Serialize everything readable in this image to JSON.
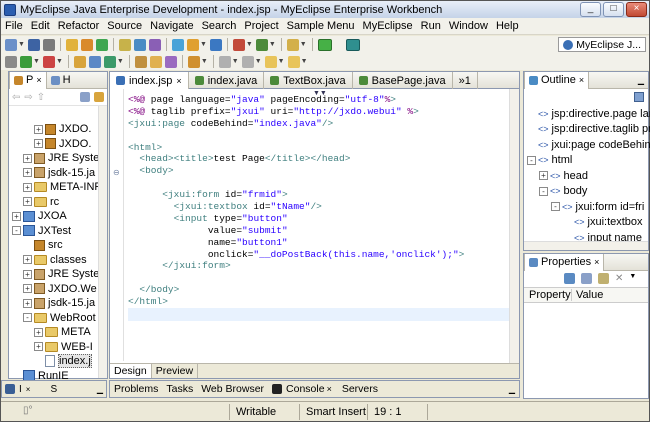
{
  "window": {
    "title": "MyEclipse Java Enterprise Development - index.jsp - MyEclipse Enterprise Workbench",
    "minimize": "_",
    "maximize": "□",
    "close": "×"
  },
  "menu": [
    "File",
    "Edit",
    "Refactor",
    "Source",
    "Navigate",
    "Search",
    "Project",
    "Sample Menu",
    "MyEclipse",
    "Run",
    "Window",
    "Help"
  ],
  "perspective": {
    "label": "MyEclipse J..."
  },
  "package_explorer": {
    "tabs": [
      "P",
      "H"
    ],
    "items": [
      {
        "label": "JXDO.",
        "type": "pkg",
        "indent": 2,
        "exp": "+"
      },
      {
        "label": "JXDO.",
        "type": "pkg",
        "indent": 2,
        "exp": "+"
      },
      {
        "label": "JRE Syste",
        "type": "jar",
        "indent": 1,
        "exp": "+"
      },
      {
        "label": "jsdk-15.ja",
        "type": "jar",
        "indent": 1,
        "exp": "+"
      },
      {
        "label": "META-INF",
        "type": "fold",
        "indent": 1,
        "exp": "+"
      },
      {
        "label": "rc",
        "type": "fold",
        "indent": 1,
        "exp": "+"
      },
      {
        "label": "JXOA",
        "type": "prj",
        "indent": 0,
        "exp": "+"
      },
      {
        "label": "JXTest",
        "type": "prj",
        "indent": 0,
        "exp": "-"
      },
      {
        "label": "src",
        "type": "pkg",
        "indent": 1,
        "exp": ""
      },
      {
        "label": "classes",
        "type": "fold",
        "indent": 1,
        "exp": "+"
      },
      {
        "label": "JRE Syste",
        "type": "jar",
        "indent": 1,
        "exp": "+"
      },
      {
        "label": "JXDO.We",
        "type": "jar",
        "indent": 1,
        "exp": "+"
      },
      {
        "label": "jsdk-15.ja",
        "type": "jar",
        "indent": 1,
        "exp": "+"
      },
      {
        "label": "WebRoot",
        "type": "fold",
        "indent": 1,
        "exp": "-"
      },
      {
        "label": "META",
        "type": "fold",
        "indent": 2,
        "exp": "+"
      },
      {
        "label": "WEB-I",
        "type": "fold",
        "indent": 2,
        "exp": "+"
      },
      {
        "label": "index.j",
        "type": "file",
        "indent": 2,
        "exp": ""
      },
      {
        "label": "RunIE",
        "type": "prj",
        "indent": 0,
        "exp": ""
      }
    ]
  },
  "editor": {
    "tabs": [
      {
        "label": "index.jsp",
        "active": true
      },
      {
        "label": "index.java",
        "active": false
      },
      {
        "label": "TextBox.java",
        "active": false
      },
      {
        "label": "BasePage.java",
        "active": false
      },
      {
        "label": "»1",
        "active": false
      }
    ],
    "lines": [
      "<%@ page language=\"java\" pageEncoding=\"utf-8\"%>",
      "<%@ taglib prefix=\"jxui\" uri=\"http://jxdo.webui\" %>",
      "<jxui:page codeBehind=\"index.java\"/>",
      "",
      "<html>",
      "  <head><title>test Page</title></head>",
      "  <body>",
      "",
      "      <jxui:form id=\"frmid\">",
      "        <jxui:textbox id=\"tName\"/>",
      "        <input type=\"button\"",
      "              value=\"submit\"",
      "              name=\"button1\"",
      "              onclick=\"__doPostBack(this.name,'onclick');\">",
      "      </jxui:form>",
      "",
      "  </body>",
      "</html>"
    ],
    "bottom_tabs": [
      "Design",
      "Preview"
    ]
  },
  "outline": {
    "title": "Outline",
    "items": [
      {
        "label": "jsp:directive.page lan",
        "indent": 0,
        "exp": ""
      },
      {
        "label": "jsp:directive.taglib pr",
        "indent": 0,
        "exp": ""
      },
      {
        "label": "jxui:page codeBehind",
        "indent": 0,
        "exp": ""
      },
      {
        "label": "html",
        "indent": 0,
        "exp": "-"
      },
      {
        "label": "head",
        "indent": 1,
        "exp": "+"
      },
      {
        "label": "body",
        "indent": 1,
        "exp": "-"
      },
      {
        "label": "jxui:form id=fri",
        "indent": 2,
        "exp": "-"
      },
      {
        "label": "jxui:textbox",
        "indent": 3,
        "exp": ""
      },
      {
        "label": "input name",
        "indent": 3,
        "exp": ""
      }
    ]
  },
  "properties": {
    "title": "Properties",
    "col_property": "Property",
    "col_value": "Value"
  },
  "console_tabs": [
    "Problems",
    "Tasks",
    "Web Browser",
    "Console",
    "Servers"
  ],
  "mini_tabs": [
    "I",
    "S"
  ],
  "status": {
    "writable": "Writable",
    "insert": "Smart Insert",
    "position": "19 : 1"
  }
}
